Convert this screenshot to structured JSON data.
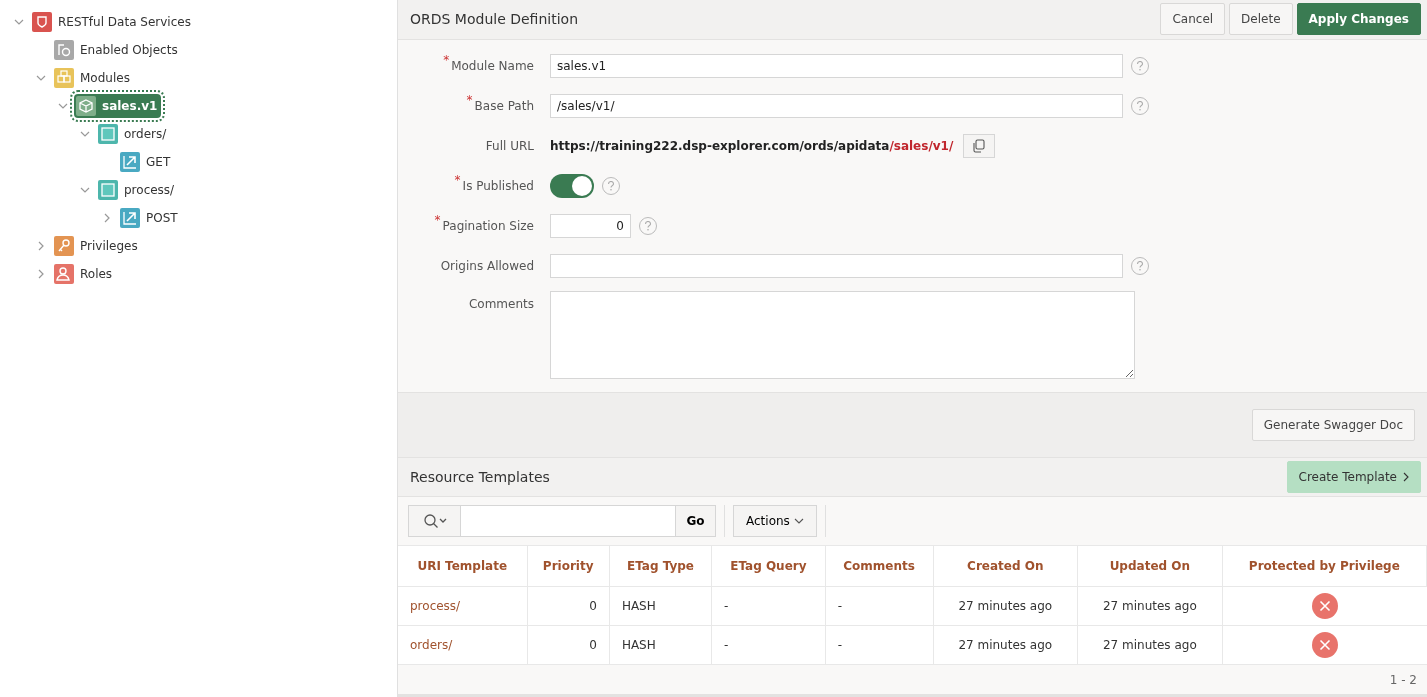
{
  "tree": [
    {
      "label": "RESTful Data Services",
      "kind": "service",
      "expanded": true,
      "selected": false,
      "children": [
        {
          "label": "Enabled Objects",
          "kind": "objects",
          "selected": false
        },
        {
          "label": "Modules",
          "kind": "modules",
          "expanded": true,
          "selected": false,
          "children": [
            {
              "label": "sales.v1",
              "kind": "module",
              "expanded": true,
              "selected": true,
              "children": [
                {
                  "label": "orders/",
                  "kind": "template",
                  "expanded": true,
                  "selected": false,
                  "children": [
                    {
                      "label": "GET",
                      "kind": "handler",
                      "selected": false
                    }
                  ]
                },
                {
                  "label": "process/",
                  "kind": "template",
                  "expanded": true,
                  "selected": false,
                  "children": [
                    {
                      "label": "POST",
                      "kind": "handler",
                      "expanded": false,
                      "selected": false
                    }
                  ]
                }
              ]
            }
          ]
        },
        {
          "label": "Privileges",
          "kind": "privilege",
          "expanded": false,
          "selected": false
        },
        {
          "label": "Roles",
          "kind": "role",
          "expanded": false,
          "selected": false
        }
      ]
    }
  ],
  "form": {
    "title": "ORDS Module Definition",
    "buttons": [
      {
        "label": "Cancel",
        "kind": "plain"
      },
      {
        "label": "Delete",
        "kind": "plain"
      },
      {
        "label": "Apply Changes",
        "kind": "primary"
      }
    ],
    "fields": [
      {
        "kind": "text",
        "label": "Module Name",
        "required_mark": "*",
        "value": "sales.v1",
        "help": true
      },
      {
        "kind": "text",
        "label": "Base Path",
        "required_mark": "*",
        "value": "/sales/v1/",
        "help": true
      },
      {
        "kind": "url",
        "label": "Full URL",
        "value": "https://training222.dsp-explorer.com/ords/apidata",
        "path": "/sales/v1/"
      },
      {
        "kind": "switch",
        "label": "Is Published",
        "required_mark": "*",
        "on": true,
        "help": true
      },
      {
        "kind": "number",
        "label": "Pagination Size",
        "required_mark": "*",
        "value": "0",
        "help": true
      },
      {
        "kind": "text",
        "label": "Origins Allowed",
        "help": true
      },
      {
        "kind": "textarea",
        "label": "Comments"
      }
    ],
    "footer_button": "Generate Swagger Doc"
  },
  "resource_templates": {
    "title": "Resource Templates",
    "create_button": "Create Template",
    "go_button": "Go",
    "actions_button": "Actions",
    "columns": [
      "URI Template",
      "Priority",
      "ETag Type",
      "ETag Query",
      "Comments",
      "Created On",
      "Updated On",
      "Protected by Privilege"
    ],
    "rows": [
      {
        "uri": "process/",
        "priority": "0",
        "etag_type": "HASH",
        "etag_query": "-",
        "comments": "-",
        "created": "27 minutes ago",
        "updated": "27 minutes ago",
        "protected": false
      },
      {
        "uri": "orders/",
        "priority": "0",
        "etag_type": "HASH",
        "etag_query": "-",
        "comments": "-",
        "created": "27 minutes ago",
        "updated": "27 minutes ago",
        "protected": false
      }
    ],
    "pagination": "1 - 2"
  }
}
